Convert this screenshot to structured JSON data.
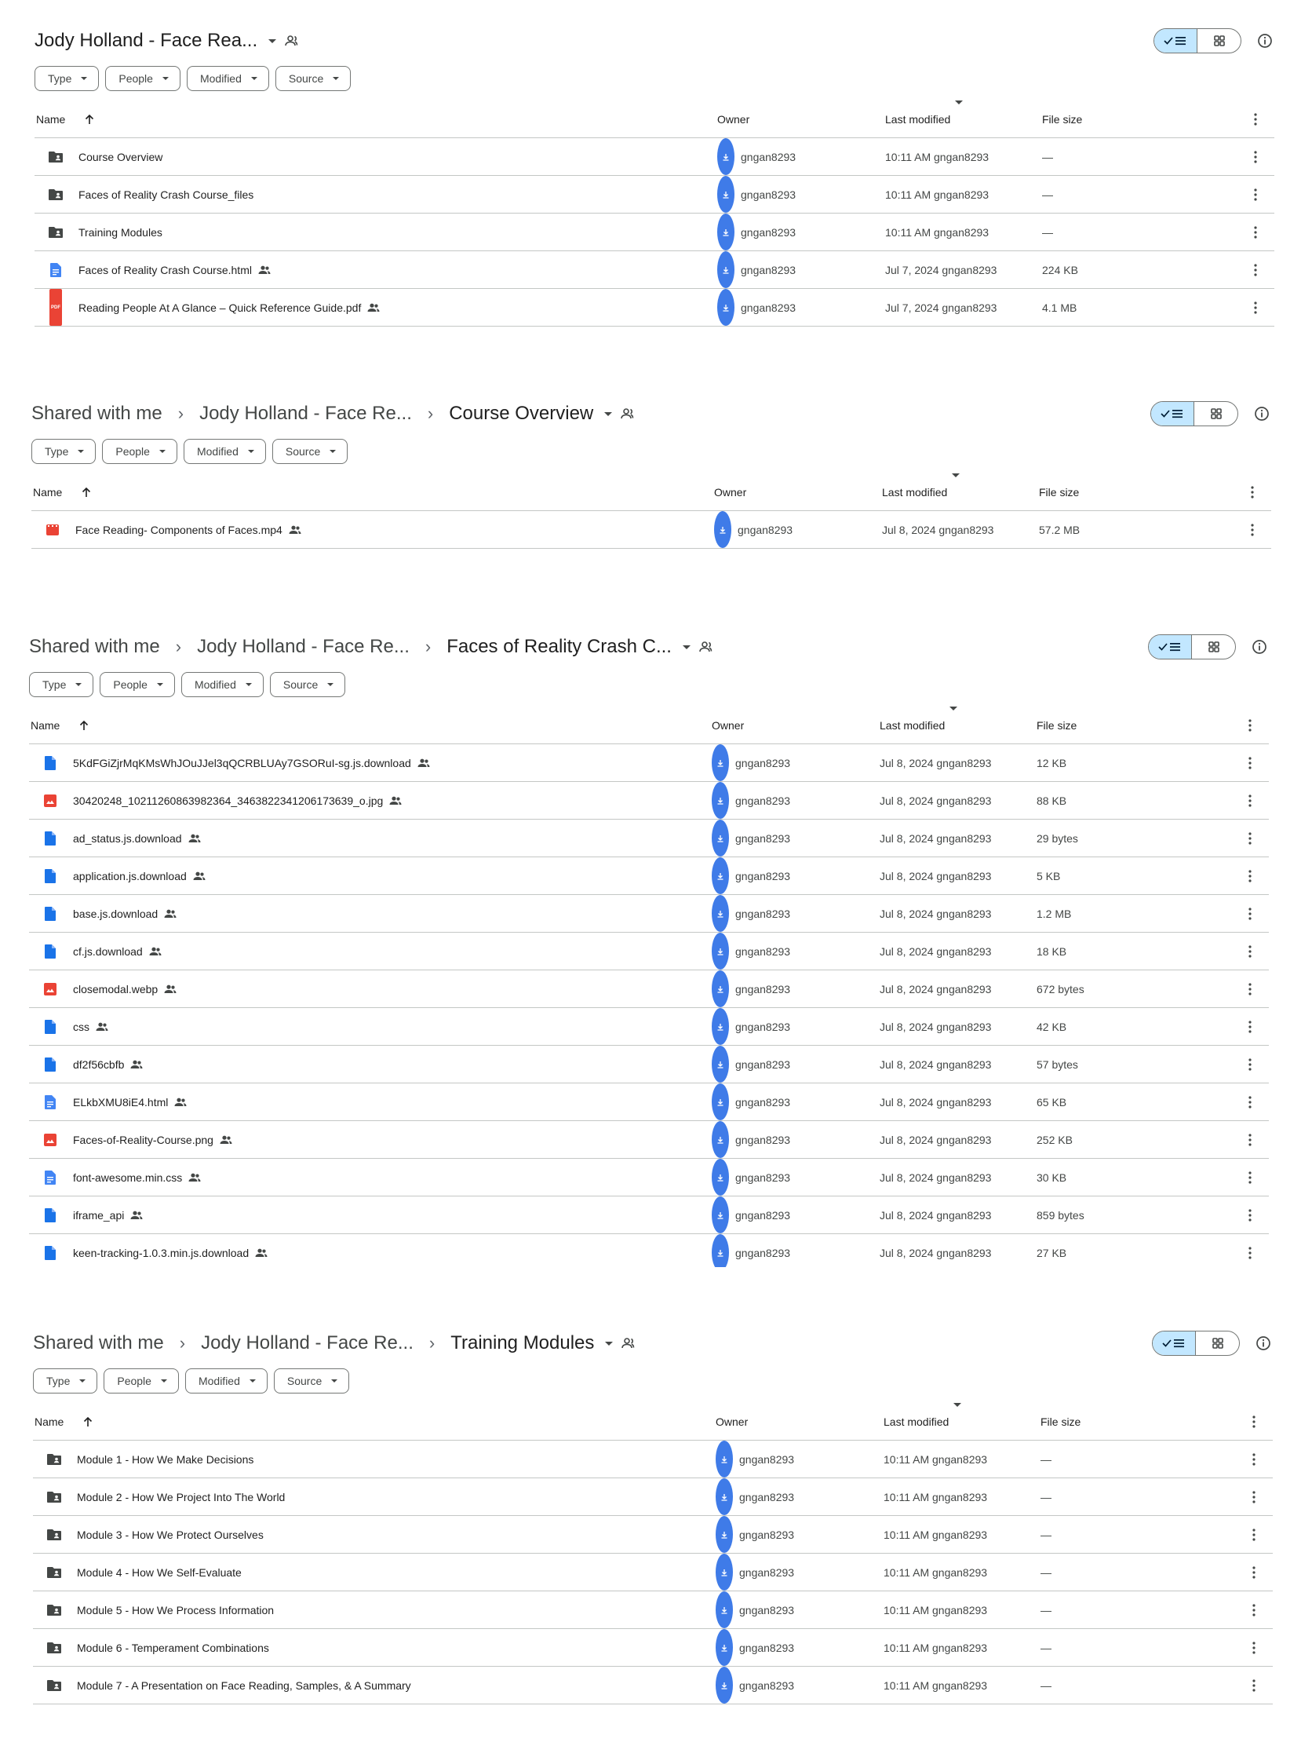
{
  "filters": [
    "Type",
    "People",
    "Modified",
    "Source"
  ],
  "columns": {
    "name": "Name",
    "owner": "Owner",
    "last_modified": "Last modified",
    "file_size": "File size"
  },
  "panels": [
    {
      "breadcrumbs": [
        "Jody Holland - Face Rea..."
      ],
      "rows": [
        {
          "name": "Course Overview",
          "icon": "shared-folder-icon",
          "shared": false,
          "owner": "gngan8293",
          "modified": "10:11 AM gngan8293",
          "size": "—"
        },
        {
          "name": "Faces of Reality Crash Course_files",
          "icon": "shared-folder-icon",
          "shared": false,
          "owner": "gngan8293",
          "modified": "10:11 AM gngan8293",
          "size": "—"
        },
        {
          "name": "Training Modules",
          "icon": "shared-folder-icon",
          "shared": false,
          "owner": "gngan8293",
          "modified": "10:11 AM gngan8293",
          "size": "—"
        },
        {
          "name": "Faces of Reality Crash Course.html",
          "icon": "doc-icon",
          "shared": true,
          "owner": "gngan8293",
          "modified": "Jul 7, 2024 gngan8293",
          "size": "224 KB"
        },
        {
          "name": "Reading People At A Glance – Quick Reference Guide.pdf",
          "icon": "pdf-icon",
          "shared": true,
          "owner": "gngan8293",
          "modified": "Jul 7, 2024 gngan8293",
          "size": "4.1 MB"
        }
      ]
    },
    {
      "breadcrumbs": [
        "Shared with me",
        "Jody Holland - Face Re...",
        "Course Overview"
      ],
      "rows": [
        {
          "name": "Face Reading- Components of Faces.mp4",
          "icon": "video-icon",
          "shared": true,
          "owner": "gngan8293",
          "modified": "Jul 8, 2024 gngan8293",
          "size": "57.2 MB"
        }
      ]
    },
    {
      "breadcrumbs": [
        "Shared with me",
        "Jody Holland - Face Re...",
        "Faces of Reality Crash C..."
      ],
      "rows": [
        {
          "name": "5KdFGiZjrMqKMsWhJOuJJel3qQCRBLUAy7GSORuI-sg.js.download",
          "icon": "file-icon",
          "shared": true,
          "owner": "gngan8293",
          "modified": "Jul 8, 2024 gngan8293",
          "size": "12 KB"
        },
        {
          "name": "30420248_10211260863982364_3463822341206173639_o.jpg",
          "icon": "image-icon",
          "shared": true,
          "owner": "gngan8293",
          "modified": "Jul 8, 2024 gngan8293",
          "size": "88 KB"
        },
        {
          "name": "ad_status.js.download",
          "icon": "file-icon",
          "shared": true,
          "owner": "gngan8293",
          "modified": "Jul 8, 2024 gngan8293",
          "size": "29 bytes"
        },
        {
          "name": "application.js.download",
          "icon": "file-icon",
          "shared": true,
          "owner": "gngan8293",
          "modified": "Jul 8, 2024 gngan8293",
          "size": "5 KB"
        },
        {
          "name": "base.js.download",
          "icon": "file-icon",
          "shared": true,
          "owner": "gngan8293",
          "modified": "Jul 8, 2024 gngan8293",
          "size": "1.2 MB"
        },
        {
          "name": "cf.js.download",
          "icon": "file-icon",
          "shared": true,
          "owner": "gngan8293",
          "modified": "Jul 8, 2024 gngan8293",
          "size": "18 KB"
        },
        {
          "name": "closemodal.webp",
          "icon": "image-icon",
          "shared": true,
          "owner": "gngan8293",
          "modified": "Jul 8, 2024 gngan8293",
          "size": "672 bytes"
        },
        {
          "name": "css",
          "icon": "file-icon",
          "shared": true,
          "owner": "gngan8293",
          "modified": "Jul 8, 2024 gngan8293",
          "size": "42 KB"
        },
        {
          "name": "df2f56cbfb",
          "icon": "file-icon",
          "shared": true,
          "owner": "gngan8293",
          "modified": "Jul 8, 2024 gngan8293",
          "size": "57 bytes"
        },
        {
          "name": "ELkbXMU8iE4.html",
          "icon": "doc-icon",
          "shared": true,
          "owner": "gngan8293",
          "modified": "Jul 8, 2024 gngan8293",
          "size": "65 KB"
        },
        {
          "name": "Faces-of-Reality-Course.png",
          "icon": "image-icon",
          "shared": true,
          "owner": "gngan8293",
          "modified": "Jul 8, 2024 gngan8293",
          "size": "252 KB"
        },
        {
          "name": "font-awesome.min.css",
          "icon": "doc-icon",
          "shared": true,
          "owner": "gngan8293",
          "modified": "Jul 8, 2024 gngan8293",
          "size": "30 KB"
        },
        {
          "name": "iframe_api",
          "icon": "file-icon",
          "shared": true,
          "owner": "gngan8293",
          "modified": "Jul 8, 2024 gngan8293",
          "size": "859 bytes"
        },
        {
          "name": "keen-tracking-1.0.3.min.js.download",
          "icon": "file-icon",
          "shared": true,
          "owner": "gngan8293",
          "modified": "Jul 8, 2024 gngan8293",
          "size": "27 KB"
        }
      ]
    },
    {
      "breadcrumbs": [
        "Shared with me",
        "Jody Holland - Face Re...",
        "Training Modules"
      ],
      "rows": [
        {
          "name": "Module 1 - How We Make Decisions",
          "icon": "shared-folder-icon",
          "shared": false,
          "owner": "gngan8293",
          "modified": "10:11 AM gngan8293",
          "size": "—"
        },
        {
          "name": "Module 2 - How We Project Into The World",
          "icon": "shared-folder-icon",
          "shared": false,
          "owner": "gngan8293",
          "modified": "10:11 AM gngan8293",
          "size": "—"
        },
        {
          "name": "Module 3 - How We Protect Ourselves",
          "icon": "shared-folder-icon",
          "shared": false,
          "owner": "gngan8293",
          "modified": "10:11 AM gngan8293",
          "size": "—"
        },
        {
          "name": "Module 4 - How We Self-Evaluate",
          "icon": "shared-folder-icon",
          "shared": false,
          "owner": "gngan8293",
          "modified": "10:11 AM gngan8293",
          "size": "—"
        },
        {
          "name": "Module 5 - How We Process Information",
          "icon": "shared-folder-icon",
          "shared": false,
          "owner": "gngan8293",
          "modified": "10:11 AM gngan8293",
          "size": "—"
        },
        {
          "name": "Module 6 - Temperament Combinations",
          "icon": "shared-folder-icon",
          "shared": false,
          "owner": "gngan8293",
          "modified": "10:11 AM gngan8293",
          "size": "—"
        },
        {
          "name": "Module 7 - A Presentation on Face Reading, Samples, & A Summary",
          "icon": "shared-folder-icon",
          "shared": false,
          "owner": "gngan8293",
          "modified": "10:11 AM gngan8293",
          "size": "—"
        }
      ]
    }
  ]
}
